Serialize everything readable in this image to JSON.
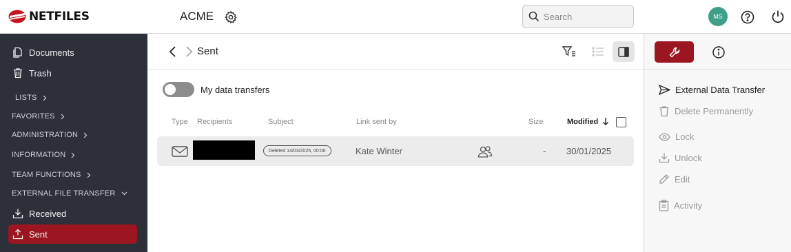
{
  "brand": {
    "name": "NETFILES",
    "accent": "#9b1620"
  },
  "header": {
    "company": "ACME",
    "search_placeholder": "Search",
    "avatar_initials": "MS",
    "avatar_color": "#3fa08a"
  },
  "sidebar": {
    "documents": "Documents",
    "trash": "Trash",
    "sections": [
      "LISTS",
      "FAVORITES",
      "ADMINISTRATION",
      "INFORMATION",
      "TEAM FUNCTIONS",
      "EXTERNAL FILE TRANSFER"
    ],
    "received": "Received",
    "sent": "Sent"
  },
  "main": {
    "title": "Sent",
    "toggle_label": "My data transfers",
    "columns": {
      "type": "Type",
      "recipients": "Recipients",
      "subject": "Subject",
      "link_sent_by": "Link sent by",
      "size": "Size",
      "modified": "Modified"
    },
    "rows": [
      {
        "subject_badge": "Deleted 14/03/2025, 00:00",
        "sender": "Kate Winter",
        "size": "-",
        "modified": "30/01/2025"
      }
    ]
  },
  "panel": {
    "actions": {
      "external_transfer": "External Data Transfer",
      "delete": "Delete Permanently",
      "lock": "Lock",
      "unlock": "Unlock",
      "edit": "Edit",
      "activity": "Activity"
    }
  }
}
